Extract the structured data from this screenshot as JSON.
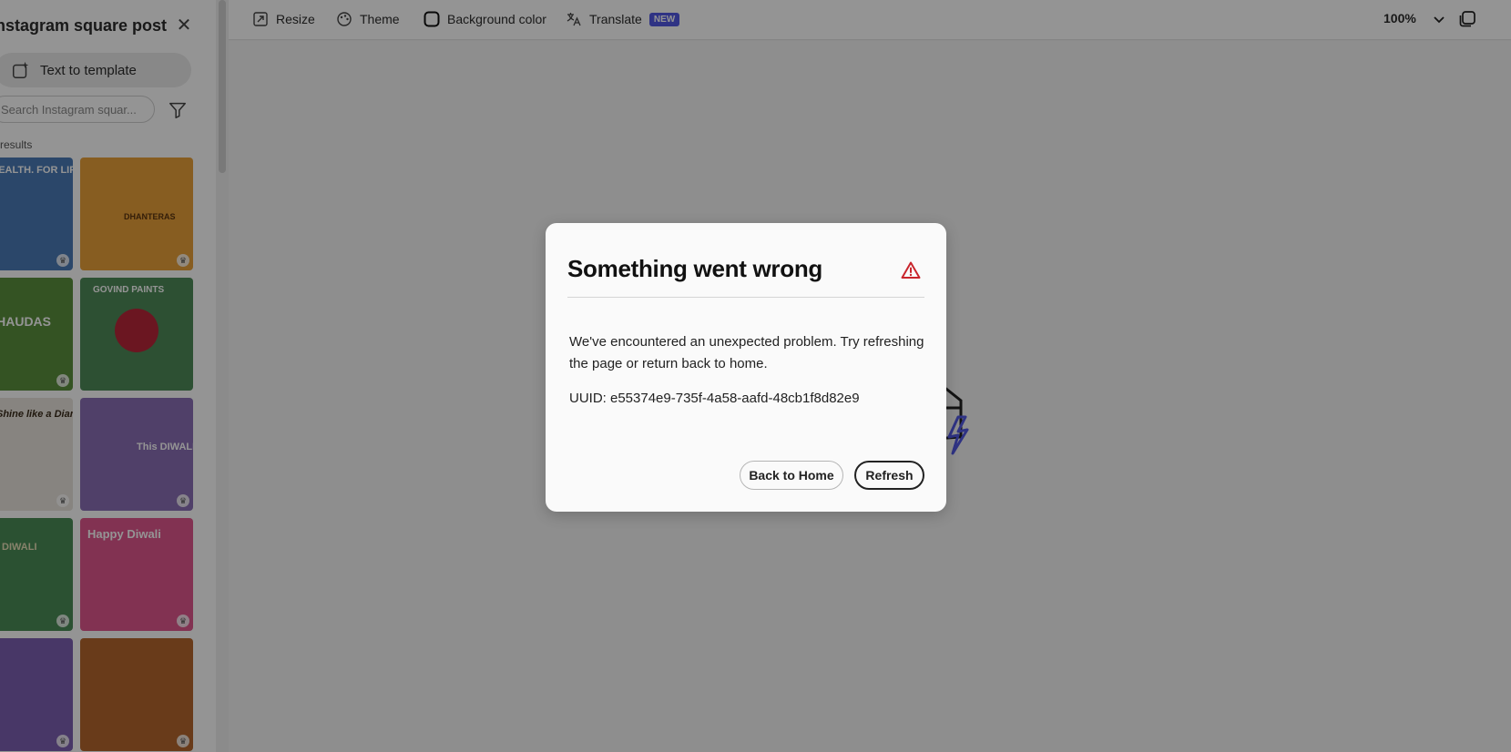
{
  "left_panel": {
    "title": "Instagram square post",
    "text_to_template": "Text to template",
    "search_placeholder": "Search Instagram squar...",
    "results_label": "results",
    "thumbnails": [
      {
        "text": "FOR HEALTH. FOR LIFE.",
        "color": "#4a7bb7"
      },
      {
        "text": "DHANTERAS",
        "color": "#e8a13a"
      },
      {
        "text": "CHAUDAS",
        "color": "#5a8f3d"
      },
      {
        "text": "GOVIND PAINTS",
        "color": "#4e8a58"
      },
      {
        "text": "Shine like a Diamond",
        "color": "#e8e4dc"
      },
      {
        "text": "This DIWALI",
        "color": "#8a6fb5"
      },
      {
        "text": "DIWALI",
        "color": "#4b8c56"
      },
      {
        "text": "Happy Diwali",
        "color": "#e0568d"
      },
      {
        "text": "",
        "color": "#7d5fb2"
      },
      {
        "text": "",
        "color": "#b5662e"
      }
    ]
  },
  "toolbar": {
    "resize": "Resize",
    "theme": "Theme",
    "background_color": "Background color",
    "translate": "Translate",
    "new_badge": "NEW",
    "zoom": "100%"
  },
  "dialog": {
    "title": "Something went wrong",
    "body": "We've encountered an unexpected problem. Try refreshing the page or return back to home.",
    "uuid": "UUID: e55374e9-735f-4a58-aafd-48cb1f8d82e9",
    "back_home": "Back to Home",
    "refresh": "Refresh"
  },
  "colors": {
    "accent_new": "#5258e4",
    "alert_red": "#c9252c",
    "overlay": "rgba(0,0,0,0.42)"
  }
}
